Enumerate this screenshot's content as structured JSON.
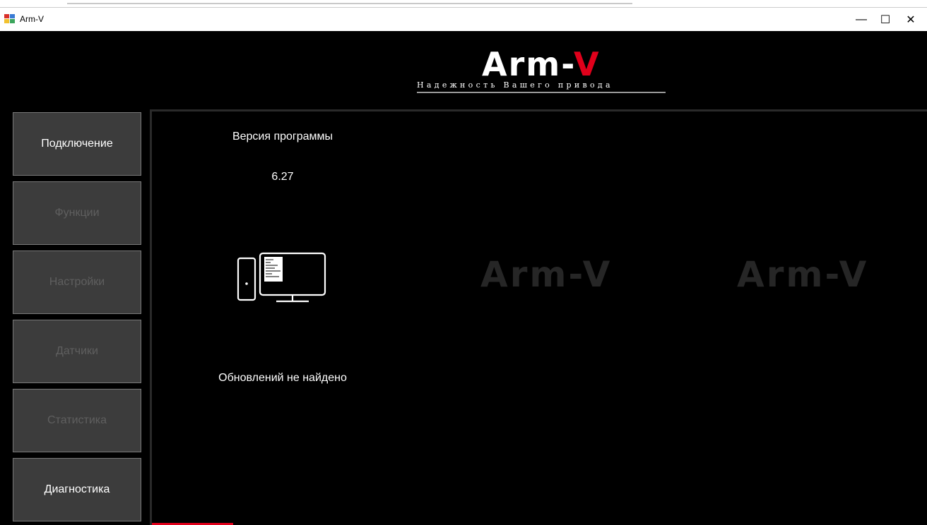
{
  "window": {
    "title": "Arm-V",
    "minimize_glyph": "—",
    "maximize_glyph": "☐",
    "close_glyph": "✕"
  },
  "logo": {
    "word_main": "Arm-",
    "word_accent": "V",
    "tagline": "Надежность Вашего привода"
  },
  "nav": [
    {
      "label": "Подключение",
      "active": true
    },
    {
      "label": "Функции",
      "active": false
    },
    {
      "label": "Настройки",
      "active": false
    },
    {
      "label": "Датчики",
      "active": false
    },
    {
      "label": "Статистика",
      "active": false
    },
    {
      "label": "Диагностика",
      "active": true
    }
  ],
  "main": {
    "version_label": "Версия программы",
    "version_value": "6.27",
    "update_status": "Обновлений не найдено",
    "watermark_left": "Arm-V",
    "watermark_right": "Arm-V"
  },
  "colors": {
    "accent": "#e0001b",
    "nav_bg": "#3c3c3c",
    "nav_inactive_text": "#5f5f5f"
  },
  "icons": [
    "app-icon",
    "computer-icon"
  ]
}
